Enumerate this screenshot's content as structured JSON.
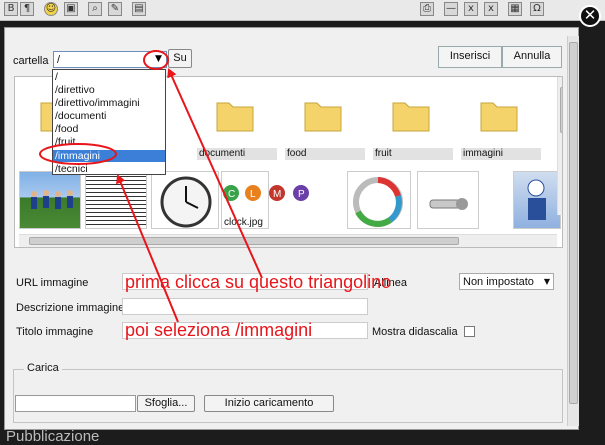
{
  "background_text": "Pubblicazione",
  "close_glyph": "✕",
  "dialog": {
    "folder_label": "cartella",
    "folder_value": "/",
    "up_button": "Su",
    "insert_button": "Inserisci",
    "cancel_button": "Annulla",
    "folder_options": [
      "/",
      "/direttivo",
      "/direttivo/immagini",
      "/documenti",
      "/food",
      "/fruit",
      "/immagini",
      "/tecnici"
    ],
    "selected_option": "/immagini",
    "folders": [
      "documenti",
      "food",
      "fruit",
      "immagini"
    ],
    "thumb_captions": [
      "clock.jpg"
    ],
    "url_label": "URL immagine",
    "align_label": "Allinea",
    "align_value": "Non impostato",
    "desc_label": "Descrizione immagine",
    "title_label": "Titolo immagine",
    "caption_label": "Mostra didascalia",
    "upload_legend": "Carica",
    "browse_button": "Sfoglia...",
    "start_upload_button": "Inizio caricamento"
  },
  "annotations": {
    "line1": "prima clicca su questo triangolino",
    "line2": "poi seleziona /immagini",
    "color": "#e8151a"
  }
}
